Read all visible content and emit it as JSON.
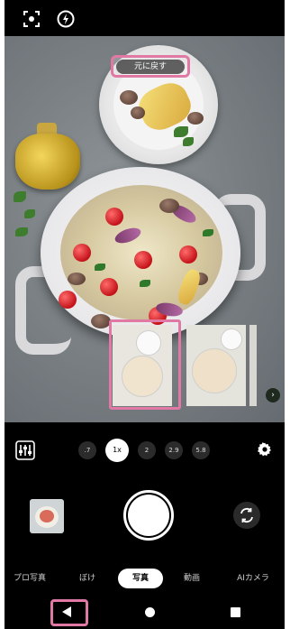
{
  "topbar": {
    "icons": [
      "focus-frame-icon",
      "flash-icon"
    ]
  },
  "viewfinder": {
    "overlay_chip_label": "元に戻す",
    "next_icon_glyph": "›"
  },
  "zoom": {
    "levels": [
      ".7",
      "1x",
      "2",
      "2.9",
      "5.8"
    ],
    "selected": "1x"
  },
  "modes": {
    "items": [
      "プロ写真",
      "ぼけ",
      "写真",
      "動画",
      "AIカメラ"
    ],
    "selected": "写真"
  },
  "colors": {
    "highlight": "#e07aa4",
    "background": "#000000"
  }
}
